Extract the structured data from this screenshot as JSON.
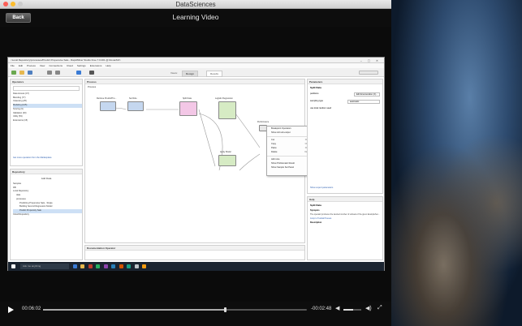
{
  "window": {
    "title": "DataSciences"
  },
  "header": {
    "back_label": "Back",
    "video_title": "Learning Video"
  },
  "video": {
    "inner_title": "<Local Repository/processes/Predict Propensive Sale - RapidMiner Studio Free 7.0.001 @ RoxanMJ>",
    "menu": [
      "File",
      "Edit",
      "Process",
      "View",
      "Connections",
      "Cloud",
      "Settings",
      "Extensions",
      "Help"
    ],
    "tabs": [
      "Views:",
      "Design",
      "Results"
    ],
    "operators_header": "Operators",
    "operators_tree": [
      "Data Access (47)",
      "Blending (77)",
      "Cleansing (25)",
      "Modeling (125)",
      "Scoring (9)",
      "Validation (30)",
      "Utility (53)",
      "Extensions (15)"
    ],
    "get_more": "Get more operators from the Marketplace",
    "repository_header": "Repository",
    "repo_add": "Add Data",
    "repo_tree": [
      "Samples",
      "DB",
      "Local Repository",
      "data",
      "processes",
      "Predicting Propensive Sale - Single",
      "Building Second Regression Model",
      "Predict Propensity Sale"
    ],
    "cloud": "Cloud Repository",
    "process_header": "Process",
    "process_path": "Process",
    "nodes": [
      "Retrieve Predict/Pro...",
      "Set Role",
      "Split Data",
      "Logistic Regression",
      "Apply Model",
      "Performance"
    ],
    "context_menu": [
      {
        "label": "Breakpoint Operators",
        "key": ""
      },
      {
        "label": "Show old sub-output",
        "key": ""
      },
      {
        "label": "Cut",
        "key": "Ctrl+X"
      },
      {
        "label": "Copy",
        "key": "Ctrl+C"
      },
      {
        "label": "Paste",
        "key": "Ctrl+V"
      },
      {
        "label": "Delete",
        "key": "Delete"
      },
      {
        "label": "Add note",
        "key": ""
      },
      {
        "label": "Show Problematic Result",
        "key": ""
      },
      {
        "label": "Show Sample Set Panel",
        "key": ""
      }
    ],
    "parameters_header": "Parameters",
    "param_title": "Split Data",
    "param_partitions": "partitions",
    "param_partitions_btn": "Edit Enumeration (2)...",
    "param_sampling": "sampling type",
    "param_sampling_value": "automatic",
    "param_local": "use local random seed",
    "param_expert": "Show expert parameters",
    "help_header": "Help",
    "help_title": "Split Data",
    "help_synopsis": "Synopsis",
    "help_text": "The operator produces the desired number of subsets of the given ExampleSet...",
    "help_link": "Jump to Tutorial Process",
    "help_desc": "Description",
    "doc_header": "Documentation Operator",
    "search_placeholder": "Ask me anything"
  },
  "controls": {
    "elapsed": "00:06:02",
    "remaining": "-00:02:48",
    "progress": 0.69,
    "volume": 0.55
  },
  "colors": {
    "accent": "#2a5db0",
    "node_pink": "#f3c7e6",
    "node_green": "#d6ebc4",
    "node_blue": "#c5d7ef"
  }
}
